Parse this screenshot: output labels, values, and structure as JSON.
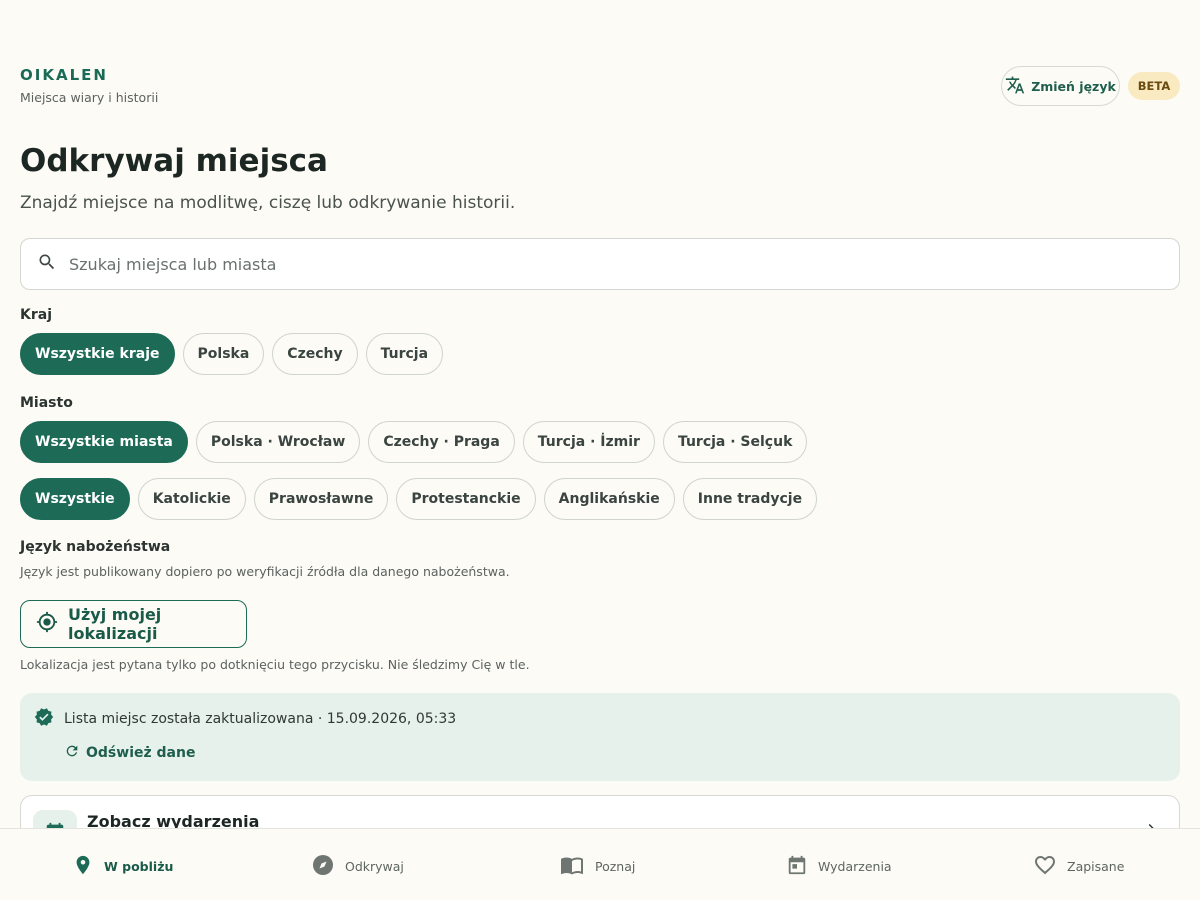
{
  "header": {
    "brand": "OIKALEN",
    "tagline": "Miejsca wiary i historii",
    "language_button": "Zmień język",
    "badge": "BETA"
  },
  "main": {
    "title": "Odkrywaj miejsca",
    "subtitle": "Znajdź miejsce na modlitwę, ciszę lub odkrywanie historii.",
    "search_placeholder": "Szukaj miejsca lub miasta"
  },
  "filters": {
    "country_label": "Kraj",
    "countries": [
      "Wszystkie kraje",
      "Polska",
      "Czechy",
      "Turcja"
    ],
    "city_label": "Miasto",
    "cities": [
      "Wszystkie miasta",
      "Polska · Wrocław",
      "Czechy · Praga",
      "Turcja · İzmir",
      "Turcja · Selçuk"
    ],
    "traditions": [
      "Wszystkie",
      "Katolickie",
      "Prawosławne",
      "Protestanckie",
      "Anglikańskie",
      "Inne tradycje"
    ],
    "service_language_label": "Język nabożeństwa",
    "service_language_help": "Język jest publikowany dopiero po weryfikacji źródła dla danego nabożeństwa."
  },
  "location": {
    "button": "Użyj mojej lokalizacji",
    "note": "Lokalizacja jest pytana tylko po dotknięciu tego przycisku. Nie śledzimy Cię w tle."
  },
  "status": {
    "message": "Lista miejsc została zaktualizowana · 15.09.2026, 05:33",
    "refresh": "Odśwież dane"
  },
  "events_card": {
    "title": "Zobacz wydarzenia"
  },
  "bottom_nav": {
    "items": [
      {
        "label": "W pobliżu",
        "icon": "location-pin-icon"
      },
      {
        "label": "Odkrywaj",
        "icon": "compass-icon"
      },
      {
        "label": "Poznaj",
        "icon": "book-icon"
      },
      {
        "label": "Wydarzenia",
        "icon": "calendar-icon"
      },
      {
        "label": "Zapisane",
        "icon": "heart-icon"
      }
    ],
    "active": "W pobliżu"
  },
  "colors": {
    "accent": "#1d6b57",
    "background": "#fdfbf6",
    "status_bg": "#e6f1ec",
    "badge_bg": "#faeac2"
  }
}
